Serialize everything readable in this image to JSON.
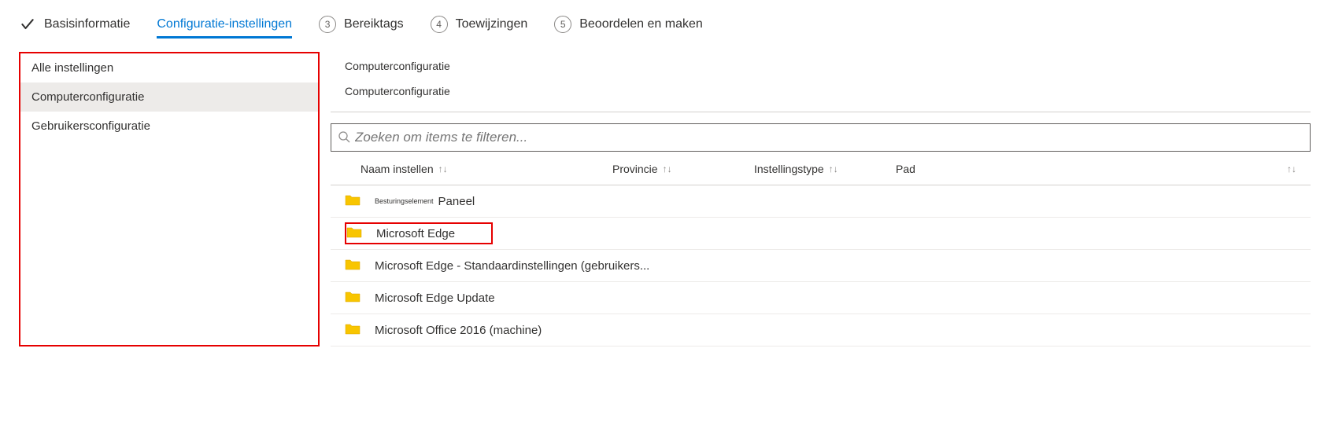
{
  "wizard": {
    "step1": "Basisinformatie",
    "step2": "Configuratie-instellingen",
    "step3_num": "3",
    "step3": "Bereiktags",
    "step4_num": "4",
    "step4": "Toewijzingen",
    "step5_num": "5",
    "step5": "Beoordelen en maken"
  },
  "sidebar": {
    "items": [
      "Alle instellingen",
      "Computerconfiguratie",
      "Gebruikersconfiguratie"
    ]
  },
  "breadcrumbs": {
    "line1": "Computerconfiguratie",
    "line2": "Computerconfiguratie"
  },
  "search": {
    "placeholder": "Zoeken om items te filteren..."
  },
  "columns": {
    "name": "Naam instellen",
    "province": "Provincie",
    "type": "Instellingstype",
    "path": "Pad"
  },
  "rows": [
    {
      "pretext": "Besturingselement",
      "label": "Paneel"
    },
    {
      "label": "Microsoft Edge",
      "highlight": true
    },
    {
      "label": "Microsoft Edge -   Standaardinstellingen (gebruikers..."
    },
    {
      "label": "Microsoft Edge Update"
    },
    {
      "label": "Microsoft Office 2016 (machine)"
    }
  ]
}
